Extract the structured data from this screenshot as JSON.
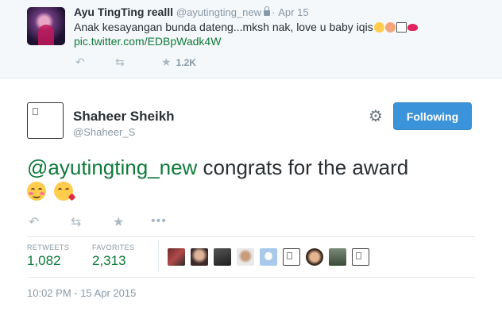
{
  "parent_tweet": {
    "name": "Ayu TingTing realll",
    "handle": "@ayutingting_new",
    "separator": "·",
    "time": "Apr 15",
    "text": "Anak kesayangan bunda dateng...mksh nak, love u baby iqis",
    "link": "pic.twitter.com/EDBpWadk4W",
    "favorite_count": "1.2K"
  },
  "main_tweet": {
    "name": "Shaheer Sheikh",
    "handle": "@Shaheer_S",
    "follow_label": "Following",
    "mention": "@ayutingting_new",
    "text": " congrats for the award",
    "stats": {
      "retweets_label": "RETWEETS",
      "retweets": "1,082",
      "favorites_label": "FAVORITES",
      "favorites": "2,313"
    },
    "timestamp": "10:02 PM - 15 Apr 2015"
  },
  "colors": {
    "accent_green": "#0f7a3b",
    "follow_blue": "#3b94d9",
    "muted": "#8899a6"
  },
  "icons": [
    "lock-icon",
    "reply-icon",
    "retweet-icon",
    "star-icon",
    "more-icon",
    "gear-icon"
  ]
}
